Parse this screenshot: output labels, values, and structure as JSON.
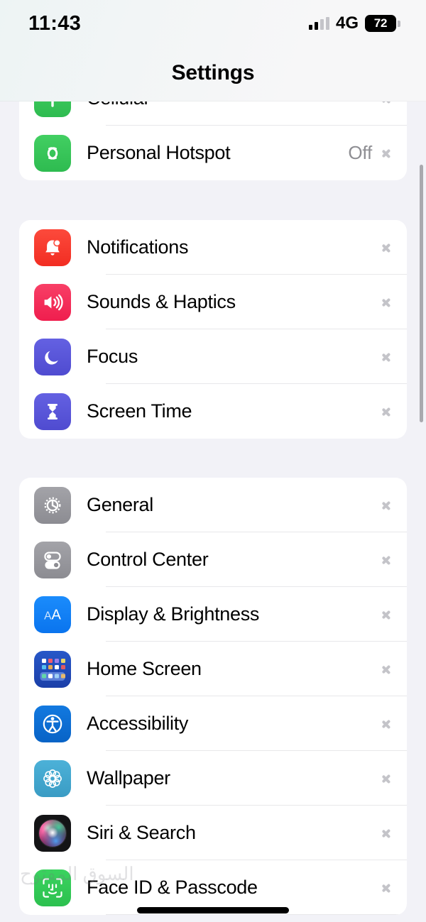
{
  "status_bar": {
    "time": "11:43",
    "network": "4G",
    "battery_percent": "72",
    "signal_bars_filled": 2,
    "signal_bars_total": 4
  },
  "header": {
    "title": "Settings"
  },
  "watermark": "السوق المفتوح",
  "colors": {
    "background": "#f2f2f7",
    "card": "#ffffff",
    "separator": "#e8e8ea",
    "secondary_text": "#8e8e93",
    "chevron": "#c4c4c9",
    "green": "#34c759",
    "red": "#fb3b30",
    "pink": "#f4285e",
    "purple": "#5a56d6",
    "gray": "#8e8e93",
    "blue": "#0b84ff",
    "home_screen_blue": "#1945b5",
    "accessibility_blue": "#0b6fd6",
    "wallpaper_blue": "#3fa4cd",
    "siri_dark": "#151517"
  },
  "groups": [
    {
      "name": "connectivity",
      "rows": [
        {
          "icon": "cellular-icon",
          "label": "Cellular",
          "value": "",
          "clipped": true
        },
        {
          "icon": "personal-hotspot-icon",
          "label": "Personal Hotspot",
          "value": "Off",
          "clipped": false
        }
      ]
    },
    {
      "name": "alerts",
      "rows": [
        {
          "icon": "notifications-icon",
          "label": "Notifications",
          "value": ""
        },
        {
          "icon": "sounds-haptics-icon",
          "label": "Sounds & Haptics",
          "value": ""
        },
        {
          "icon": "focus-icon",
          "label": "Focus",
          "value": ""
        },
        {
          "icon": "screen-time-icon",
          "label": "Screen Time",
          "value": ""
        }
      ]
    },
    {
      "name": "system",
      "rows": [
        {
          "icon": "general-gear-icon",
          "label": "General",
          "value": ""
        },
        {
          "icon": "control-center-icon",
          "label": "Control Center",
          "value": ""
        },
        {
          "icon": "display-brightness-icon",
          "label": "Display & Brightness",
          "value": ""
        },
        {
          "icon": "home-screen-icon",
          "label": "Home Screen",
          "value": ""
        },
        {
          "icon": "accessibility-icon",
          "label": "Accessibility",
          "value": ""
        },
        {
          "icon": "wallpaper-icon",
          "label": "Wallpaper",
          "value": ""
        },
        {
          "icon": "siri-search-icon",
          "label": "Siri & Search",
          "value": ""
        },
        {
          "icon": "face-id-passcode-icon",
          "label": "Face ID & Passcode",
          "value": ""
        }
      ]
    }
  ]
}
